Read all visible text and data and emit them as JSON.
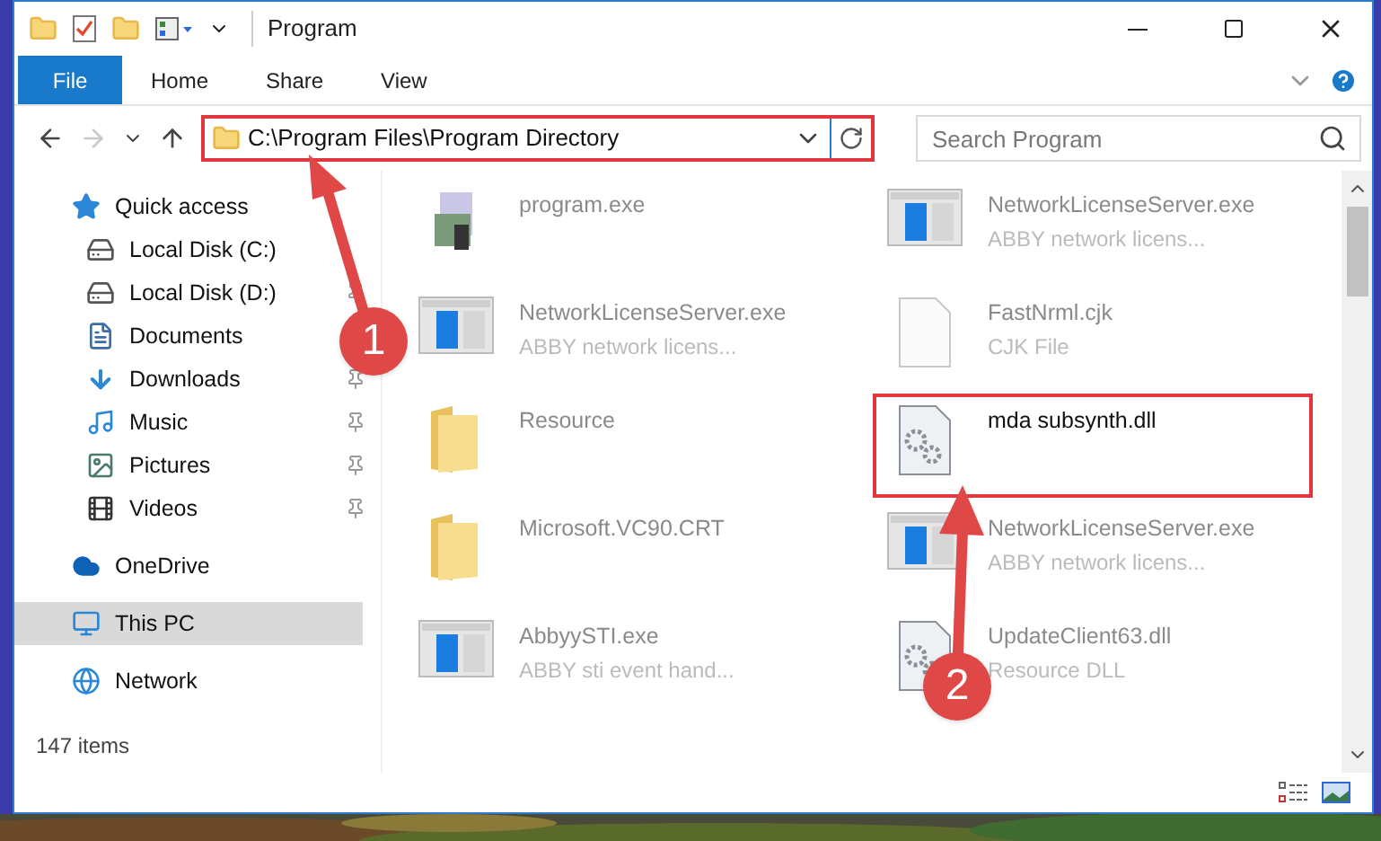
{
  "window": {
    "title": "Program"
  },
  "ribbon_tabs": [
    {
      "label": "File",
      "selected": true
    },
    {
      "label": "Home",
      "selected": false
    },
    {
      "label": "Share",
      "selected": false
    },
    {
      "label": "View",
      "selected": false
    }
  ],
  "address": {
    "path": "C:\\Program Files\\Program Directory",
    "highlighted": true
  },
  "search": {
    "placeholder": "Search Program"
  },
  "nav": [
    {
      "label": "Quick access",
      "kind": "star",
      "pinned": false,
      "selected": false,
      "children": [
        {
          "label": "Local Disk (C:)",
          "kind": "disk",
          "pinned": false,
          "selected": false
        },
        {
          "label": "Local Disk (D:)",
          "kind": "disk",
          "pinned": true,
          "selected": false
        },
        {
          "label": "Documents",
          "kind": "doc",
          "pinned": false,
          "selected": false
        },
        {
          "label": "Downloads",
          "kind": "download",
          "pinned": true,
          "selected": false
        },
        {
          "label": "Music",
          "kind": "music",
          "pinned": true,
          "selected": false
        },
        {
          "label": "Pictures",
          "kind": "pictures",
          "pinned": true,
          "selected": false
        },
        {
          "label": "Videos",
          "kind": "video",
          "pinned": true,
          "selected": false
        }
      ]
    },
    {
      "label": "OneDrive",
      "kind": "cloud",
      "pinned": false,
      "selected": false
    },
    {
      "label": "This PC",
      "kind": "pc",
      "pinned": false,
      "selected": true
    },
    {
      "label": "Network",
      "kind": "network",
      "pinned": false,
      "selected": false
    }
  ],
  "files": [
    {
      "name": "program.exe",
      "kind": "setup",
      "highlighted": false
    },
    {
      "name": "NetworkLicenseServer.exe",
      "detail": "ABBY network licens...",
      "kind": "app",
      "highlighted": false
    },
    {
      "name": "NetworkLicenseServer.exe",
      "detail": "ABBY network licens...",
      "kind": "app",
      "highlighted": false
    },
    {
      "name": "FastNrml.cjk",
      "detail": "CJK File",
      "kind": "blank",
      "highlighted": false
    },
    {
      "name": "Resource",
      "kind": "folder",
      "highlighted": false
    },
    {
      "name": "mda subsynth.dll",
      "kind": "dll",
      "highlighted": true
    },
    {
      "name": "Microsoft.VC90.CRT",
      "kind": "folder",
      "highlighted": false
    },
    {
      "name": "NetworkLicenseServer.exe",
      "detail": "ABBY network licens...",
      "kind": "app",
      "highlighted": false
    },
    {
      "name": "AbbyySTI.exe",
      "detail": "ABBY sti event hand...",
      "kind": "app",
      "highlighted": false
    },
    {
      "name": "UpdateClient63.dll",
      "detail": "Resource DLL",
      "kind": "dll",
      "highlighted": false
    }
  ],
  "status_bar": {
    "count": "147 items"
  },
  "annotations": [
    {
      "number": "1"
    },
    {
      "number": "2"
    }
  ]
}
